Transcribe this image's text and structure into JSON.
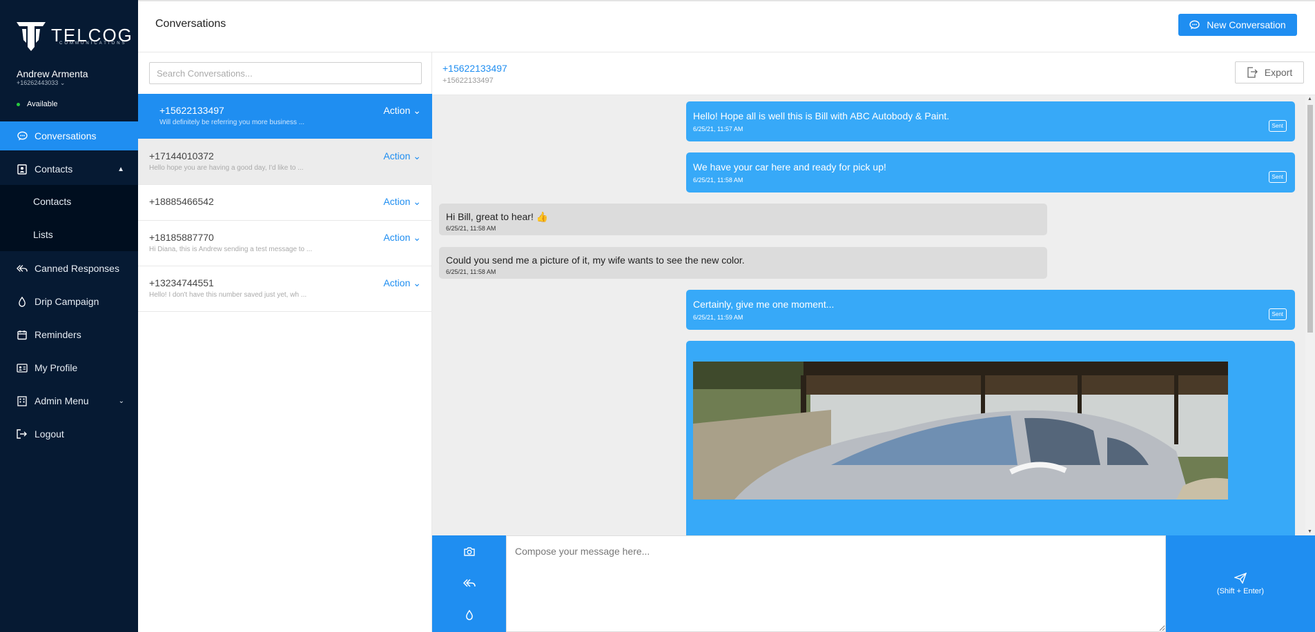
{
  "brand": {
    "name": "TELCOG",
    "tagline": "COMMUNICATIONS"
  },
  "user": {
    "name": "Andrew Armenta",
    "phone": "+16262443033",
    "status": "Available"
  },
  "sidebar": {
    "items": [
      {
        "label": "Conversations"
      },
      {
        "label": "Contacts"
      },
      {
        "label": "Contacts"
      },
      {
        "label": "Lists"
      },
      {
        "label": "Canned Responses"
      },
      {
        "label": "Drip Campaign"
      },
      {
        "label": "Reminders"
      },
      {
        "label": "My Profile"
      },
      {
        "label": "Admin Menu"
      },
      {
        "label": "Logout"
      }
    ]
  },
  "header": {
    "title": "Conversations",
    "new_button": "New Conversation"
  },
  "search": {
    "placeholder": "Search Conversations..."
  },
  "conversations": [
    {
      "number": "+15622133497",
      "preview": "Will definitely be referring you more business ...",
      "action": "Action"
    },
    {
      "number": "+17144010372",
      "preview": "Hello hope you are having a good day, I'd like to ...",
      "action": "Action"
    },
    {
      "number": "+18885466542",
      "preview": "",
      "action": "Action"
    },
    {
      "number": "+18185887770",
      "preview": "Hi Diana, this is Andrew sending a test message to ...",
      "action": "Action"
    },
    {
      "number": "+13234744551",
      "preview": "Hello! I don't have this number saved just yet, wh ...",
      "action": "Action"
    }
  ],
  "chat": {
    "number": "+15622133497",
    "subnumber": "+15622133497",
    "export_label": "Export",
    "messages": [
      {
        "direction": "out",
        "text": "Hello! Hope all is well this is Bill with ABC Autobody & Paint.",
        "time": "6/25/21, 11:57 AM",
        "status": "Sent"
      },
      {
        "direction": "out",
        "text": "We have your car here and ready for pick up!",
        "time": "6/25/21, 11:58 AM",
        "status": "Sent"
      },
      {
        "direction": "in",
        "text": "Hi Bill, great to hear! 👍",
        "time": "6/25/21, 11:58 AM"
      },
      {
        "direction": "in",
        "text": "Could you send me a picture of it, my wife wants to see the new color.",
        "time": "6/25/21, 11:58 AM"
      },
      {
        "direction": "out",
        "text": "Certainly, give me one moment...",
        "time": "6/25/21, 11:59 AM",
        "status": "Sent"
      }
    ]
  },
  "composer": {
    "placeholder": "Compose your message here...",
    "send_hint": "(Shift + Enter)"
  },
  "colors": {
    "sidebar_bg": "#061a33",
    "accent": "#1f8ef1",
    "outgoing_bubble": "#37a9f8",
    "incoming_bubble": "#dcdcdc"
  }
}
